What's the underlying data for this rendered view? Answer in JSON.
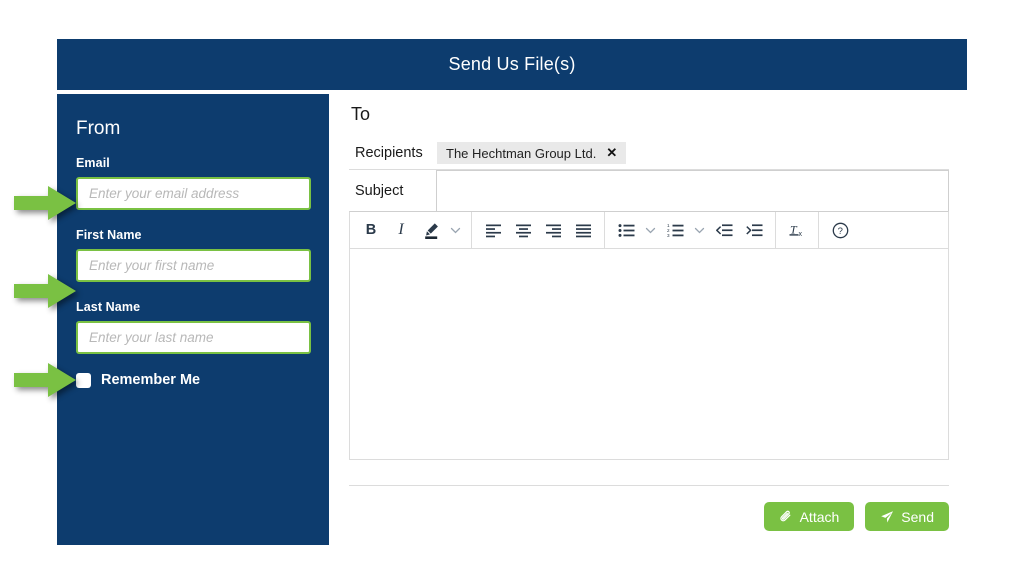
{
  "header": {
    "title": "Send Us File(s)"
  },
  "sidebar": {
    "section_title": "From",
    "fields": [
      {
        "label": "Email",
        "value": "",
        "placeholder": "Enter your email address",
        "name": "email"
      },
      {
        "label": "First Name",
        "value": "",
        "placeholder": "Enter your first name",
        "name": "first-name"
      },
      {
        "label": "Last Name",
        "value": "",
        "placeholder": "Enter your last name",
        "name": "last-name"
      }
    ],
    "remember_me": {
      "label": "Remember Me",
      "checked": false
    }
  },
  "annotations": {
    "arrow_color": "#7ac143",
    "count": 3,
    "targets": [
      "email",
      "first-name",
      "last-name"
    ]
  },
  "main": {
    "section_title": "To",
    "recipients": {
      "label": "Recipients",
      "chips": [
        {
          "text": "The Hechtman Group Ltd.",
          "remove_icon": "✕"
        }
      ]
    },
    "subject": {
      "label": "Subject",
      "value": "",
      "placeholder": ""
    },
    "toolbar": {
      "groups": [
        {
          "items": [
            {
              "icon": "bold-icon",
              "label": "B"
            },
            {
              "icon": "italic-icon",
              "label": "I"
            },
            {
              "icon": "text-color-icon",
              "label": ""
            },
            {
              "icon": "chevron-down-icon",
              "label": ""
            }
          ]
        },
        {
          "items": [
            {
              "icon": "align-left-icon",
              "label": ""
            },
            {
              "icon": "align-center-icon",
              "label": ""
            },
            {
              "icon": "align-right-icon",
              "label": ""
            },
            {
              "icon": "align-justify-icon",
              "label": ""
            }
          ]
        },
        {
          "items": [
            {
              "icon": "bulleted-list-icon",
              "label": ""
            },
            {
              "icon": "chevron-down-icon",
              "label": ""
            },
            {
              "icon": "numbered-list-icon",
              "label": ""
            },
            {
              "icon": "chevron-down-icon",
              "label": ""
            },
            {
              "icon": "outdent-icon",
              "label": ""
            },
            {
              "icon": "indent-icon",
              "label": ""
            }
          ]
        },
        {
          "items": [
            {
              "icon": "clear-formatting-icon",
              "label": ""
            }
          ]
        },
        {
          "items": [
            {
              "icon": "help-icon",
              "label": ""
            }
          ]
        }
      ]
    },
    "editor": {
      "content": "",
      "placeholder": ""
    },
    "actions": [
      {
        "label": "Attach",
        "icon": "paperclip-icon",
        "name": "attach-button"
      },
      {
        "label": "Send",
        "icon": "paper-plane-icon",
        "name": "send-button"
      }
    ]
  },
  "colors": {
    "navy": "#0d3c6e",
    "green": "#7ac143",
    "border": "#dcdcdc",
    "chip_bg": "#e9e9e9"
  }
}
